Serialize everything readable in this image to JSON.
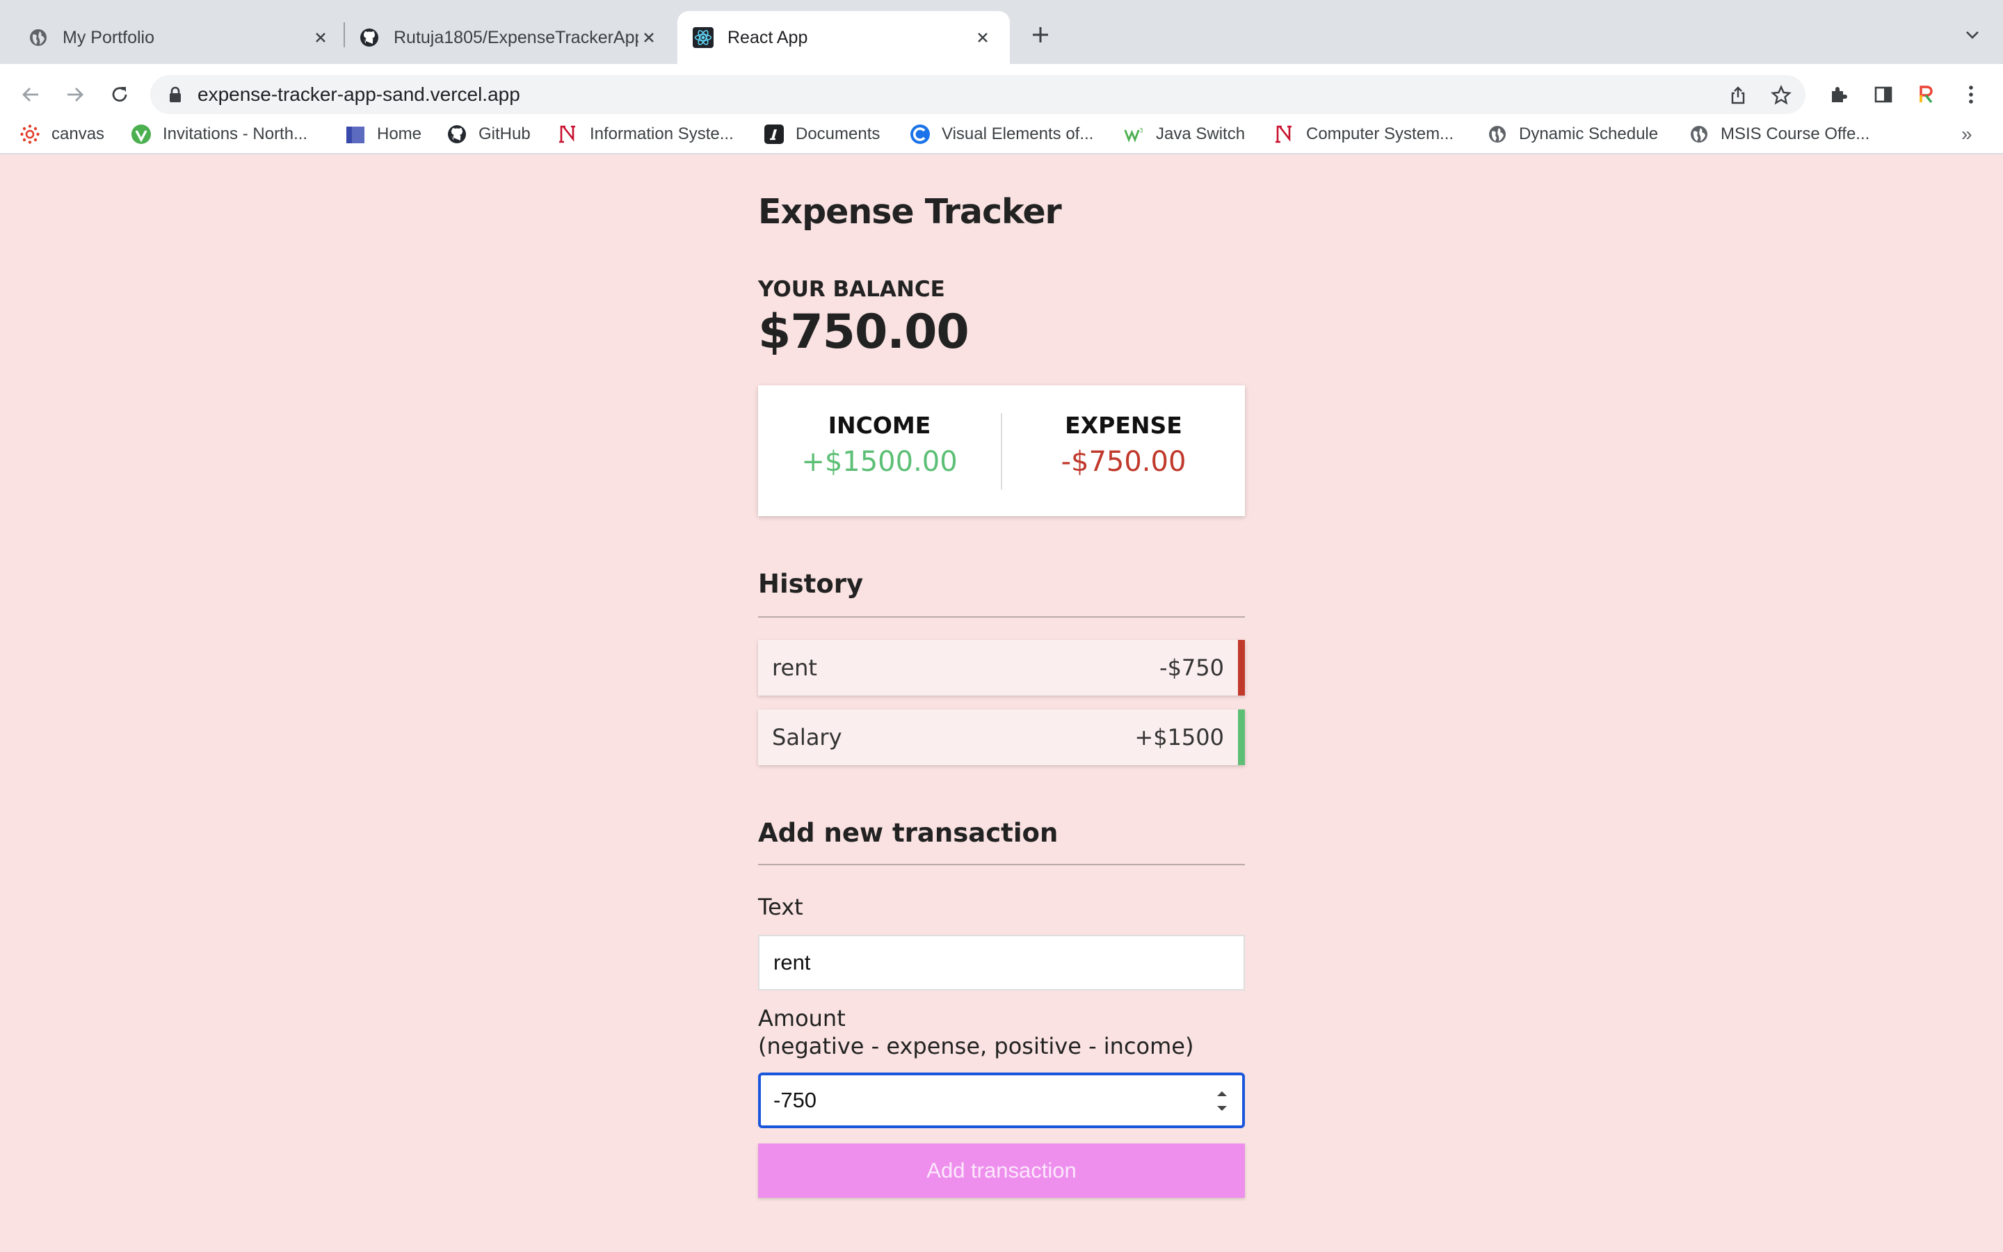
{
  "browser": {
    "tabs": [
      {
        "title": "My Portfolio",
        "icon": "globe-icon"
      },
      {
        "title": "Rutuja1805/ExpenseTrackerApp",
        "icon": "github-icon"
      },
      {
        "title": "React App",
        "icon": "react-icon",
        "active": true
      }
    ],
    "url": "expense-tracker-app-sand.vercel.app",
    "bookmarks": [
      {
        "label": "canvas",
        "icon": "canvas-icon"
      },
      {
        "label": "Invitations - North...",
        "icon": "invitations-icon"
      },
      {
        "label": "Home",
        "icon": "home-icon"
      },
      {
        "label": "GitHub",
        "icon": "github-icon"
      },
      {
        "label": "Information Syste...",
        "icon": "northeastern-icon"
      },
      {
        "label": "Documents",
        "icon": "documents-icon"
      },
      {
        "label": "Visual Elements of...",
        "icon": "visual-elements-icon"
      },
      {
        "label": "Java Switch",
        "icon": "java-icon"
      },
      {
        "label": "Computer System...",
        "icon": "northeastern-icon"
      },
      {
        "label": "Dynamic Schedule",
        "icon": "globe-icon"
      },
      {
        "label": "MSIS Course Offe...",
        "icon": "globe-icon"
      }
    ],
    "more_bookmarks": "»"
  },
  "app": {
    "title": "Expense Tracker",
    "balance_label": "YOUR BALANCE",
    "balance": "$750.00",
    "income_label": "INCOME",
    "income": "+$1500.00",
    "expense_label": "EXPENSE",
    "expense": "-$750.00",
    "history_title": "History",
    "history": [
      {
        "text": "rent",
        "amount": "-$750",
        "type": "minus"
      },
      {
        "text": "Salary",
        "amount": "+$1500",
        "type": "plus"
      }
    ],
    "add_title": "Add new transaction",
    "text_label": "Text",
    "text_value": "rent",
    "amount_label_line1": "Amount",
    "amount_label_line2": "(negative - expense, positive - income)",
    "amount_value": "-750",
    "submit_label": "Add transaction"
  },
  "colors": {
    "background": "#f9e2e1",
    "income": "#5cbf75",
    "expense": "#c0392b",
    "button": "#ee8fee",
    "focus": "#1a56db"
  }
}
